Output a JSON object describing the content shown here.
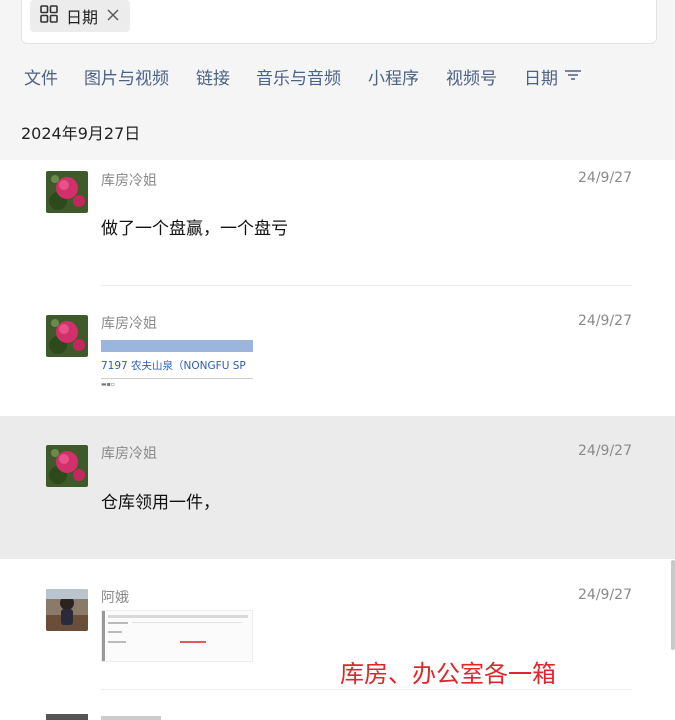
{
  "search": {
    "filter_chip": "日期"
  },
  "tabs": [
    {
      "label": "文件"
    },
    {
      "label": "图片与视频"
    },
    {
      "label": "链接"
    },
    {
      "label": "音乐与音频"
    },
    {
      "label": "小程序"
    },
    {
      "label": "视频号"
    },
    {
      "label": "日期"
    }
  ],
  "date_heading": "2024年9月27日",
  "messages": [
    {
      "sender": "库房冷姐",
      "time": "24/9/27",
      "text": "做了一个盘赢，一个盘亏"
    },
    {
      "sender": "库房冷姐",
      "time": "24/9/27",
      "link_preview": "7197 农夫山泉（NONGFU SP"
    },
    {
      "sender": "库房冷姐",
      "time": "24/9/27",
      "text": "仓库领用一件，",
      "selected": true
    },
    {
      "sender": "阿娥",
      "time": "24/9/27",
      "image_caption": "库房、办公室各一箱"
    }
  ],
  "colors": {
    "tab_text": "#4a6286",
    "accent_red": "#e0262b",
    "selected_bg": "#ebebeb"
  }
}
